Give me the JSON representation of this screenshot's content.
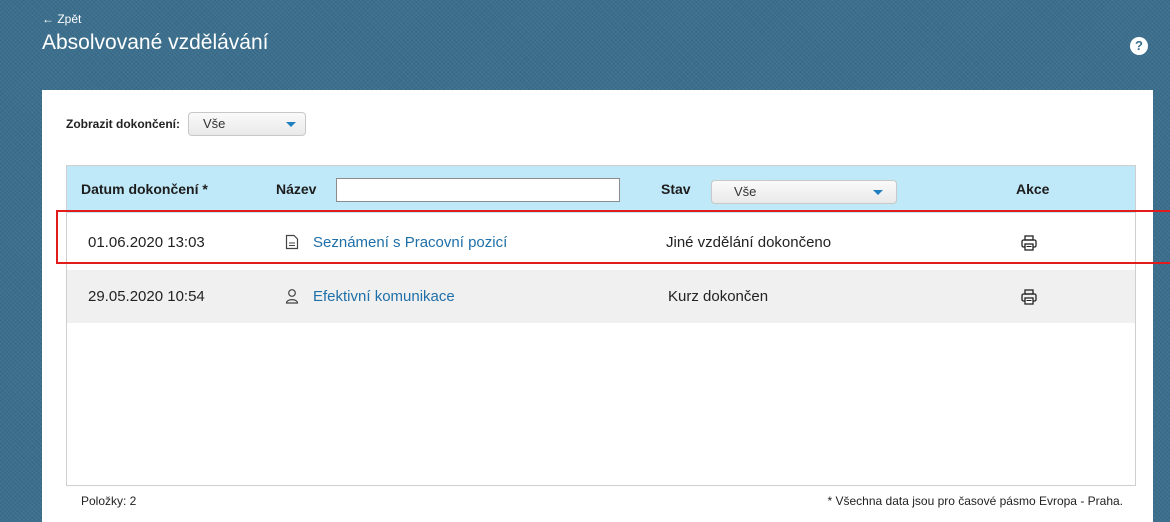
{
  "header": {
    "back_label": "← Zpět",
    "title": "Absolvované vzdělávání",
    "help_symbol": "?"
  },
  "filter": {
    "label": "Zobrazit dokončení:",
    "selected": "Vše"
  },
  "table": {
    "columns": {
      "date": "Datum dokončení *",
      "name": "Název",
      "status": "Stav",
      "action": "Akce"
    },
    "name_filter_value": "",
    "status_filter_selected": "Vše",
    "rows": [
      {
        "date": "01.06.2020 13:03",
        "icon": "document-icon",
        "name": "Seznámení s Pracovní pozicí",
        "status": "Jiné vzdělání dokončeno",
        "action_icon": "print-icon"
      },
      {
        "date": "29.05.2020 10:54",
        "icon": "person-icon",
        "name": "Efektivní komunikace",
        "status": "Kurz dokončen",
        "action_icon": "print-icon"
      }
    ]
  },
  "footer": {
    "count_label": "Položky: 2",
    "timezone_note": "* Všechna data jsou pro časové pásmo Evropa - Praha."
  },
  "colors": {
    "background": "#3b6f8d",
    "header_row": "#bfe8f8",
    "link": "#1f6fa8",
    "highlight": "#e21b1b"
  }
}
